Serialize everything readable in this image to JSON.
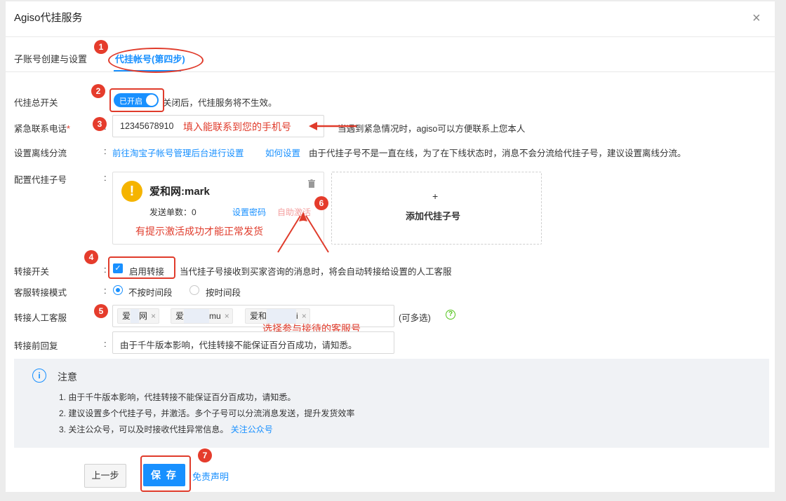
{
  "dialog": {
    "title": "Agiso代挂服务",
    "close": "×"
  },
  "tabs": [
    {
      "label": "子账号创建与设置"
    },
    {
      "label": "代挂帐号(第四步)"
    }
  ],
  "form": {
    "master_switch": {
      "label": "代挂总开关",
      "toggle_text": "已开启",
      "hint": "关闭后，代挂服务将不生效。"
    },
    "phone": {
      "label": "紧急联系电话",
      "required_mark": "*",
      "value": "12345678910",
      "hint": "当遇到紧急情况时，agiso可以方便联系上您本人"
    },
    "offline": {
      "label": "设置离线分流",
      "link1": "前往淘宝子帐号管理后台进行设置",
      "link2": "如何设置",
      "hint": "由于代挂子号不是一直在线，为了在下线状态时，消息不会分流给代挂子号，建议设置离线分流。"
    },
    "sub_accounts": {
      "label": "配置代挂子号",
      "card": {
        "name": "爱和网:mark",
        "sent_label": "发送单数：",
        "sent_value": "0",
        "set_password": "设置密码",
        "self_activate": "自助激活"
      },
      "add_label": "添加代挂子号",
      "add_icon": "+"
    },
    "transfer_switch": {
      "label": "转接开关",
      "checkbox_label": "启用转接",
      "hint": "当代挂子号接收到买家咨询的消息时，将会自动转接给设置的人工客服"
    },
    "transfer_mode": {
      "label": "客服转接模式",
      "option1": "不按时间段",
      "option2": "按时间段"
    },
    "agents": {
      "label": "转接人工客服",
      "tags": [
        "爱和网",
        "爱和网:mu",
        "爱和网:i"
      ],
      "tag_prefix": [
        "爱",
        "爱",
        "爱和"
      ],
      "tag_suffix": [
        "网",
        "mu",
        "i"
      ],
      "multi_hint": "(可多选)"
    },
    "reply": {
      "label": "转接前回复",
      "value": "由于千牛版本影响，代挂转接不能保证百分百成功，请知悉。"
    },
    "colon": ":"
  },
  "notice": {
    "title": "注意",
    "lines": [
      "1. 由于千牛版本影响，代挂转接不能保证百分百成功，请知悉。",
      "2. 建议设置多个代挂子号，并激活。多个子号可以分流消息发送，提升发货效率",
      "3. 关注公众号，可以及时接收代挂异常信息。"
    ],
    "link": "关注公众号"
  },
  "footer": {
    "prev": "上一步",
    "save": "保 存",
    "disclaimer": "免责声明"
  },
  "annotations": {
    "numbers": [
      "1",
      "2",
      "3",
      "4",
      "5",
      "6",
      "7"
    ],
    "phone_note": "填入能联系到您的手机号",
    "activate_note": "有提示激活成功才能正常发货",
    "agent_note": "选择参与接待的客服号",
    "color": "#e03b2b"
  },
  "colors": {
    "primary": "#1890ff",
    "annotation_red": "#e03b2b",
    "warning": "#f5b400"
  }
}
